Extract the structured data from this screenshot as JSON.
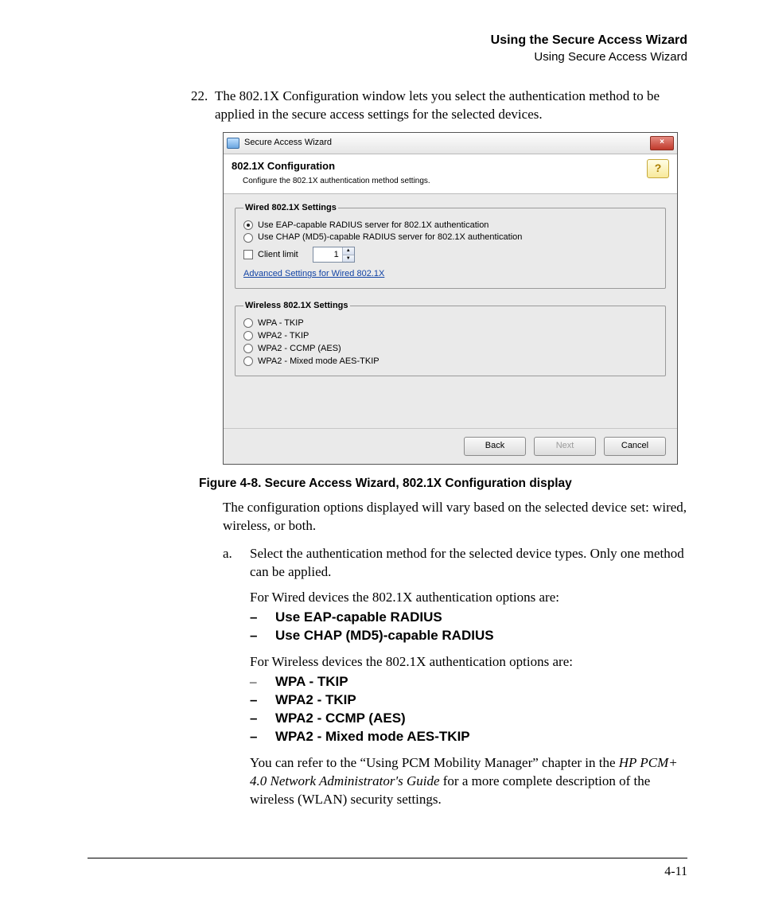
{
  "header": {
    "bold": "Using the Secure Access Wizard",
    "regular": "Using Secure Access Wizard"
  },
  "step": {
    "number": "22.",
    "text": "The 802.1X Configuration window lets you select the authentication method to be applied in the secure access settings for the selected devices."
  },
  "dialog": {
    "window_title": "Secure Access Wizard",
    "close_glyph": "×",
    "title": "802.1X Configuration",
    "subtitle": "Configure the 802.1X authentication method settings.",
    "help_glyph": "?",
    "wired": {
      "legend": "Wired 802.1X Settings",
      "opt1": "Use EAP-capable RADIUS server for 802.1X authentication",
      "opt2": "Use CHAP (MD5)-capable RADIUS server for 802.1X authentication",
      "client_limit_label": "Client limit",
      "client_limit_value": "1",
      "up": "▲",
      "down": "▼",
      "adv_link": "Advanced Settings for Wired 802.1X"
    },
    "wireless": {
      "legend": "Wireless 802.1X Settings",
      "o1": "WPA - TKIP",
      "o2": "WPA2 - TKIP",
      "o3": "WPA2 - CCMP (AES)",
      "o4": "WPA2 - Mixed mode AES-TKIP"
    },
    "buttons": {
      "back": "Back",
      "next": "Next",
      "cancel": "Cancel"
    }
  },
  "figure_caption": "Figure 4-8. Secure Access Wizard, 802.1X Configuration display",
  "after_fig": "The configuration options displayed will vary based on the selected device set: wired, wireless, or both.",
  "substep": {
    "label": "a.",
    "text": "Select the authentication method for the selected device types. Only one method can be applied."
  },
  "wired_intro": "For Wired devices the 802.1X authentication options are:",
  "wired_opts": {
    "o1": "Use EAP-capable RADIUS",
    "o2": "Use CHAP (MD5)-capable RADIUS"
  },
  "wireless_intro": "For Wireless devices the 802.1X authentication options are:",
  "wireless_opts": {
    "o1": "WPA - TKIP",
    "o2": "WPA2 - TKIP",
    "o3": "WPA2 - CCMP (AES)",
    "o4": "WPA2 - Mixed mode AES-TKIP"
  },
  "ref": {
    "p1": "You can refer to the “Using PCM Mobility Manager” chapter in the ",
    "it": "HP PCM+ 4.0 Network Administrator's Guide",
    "p2": " for a more complete description of the wireless (WLAN) security settings."
  },
  "dash": "–",
  "page_number": "4-11"
}
